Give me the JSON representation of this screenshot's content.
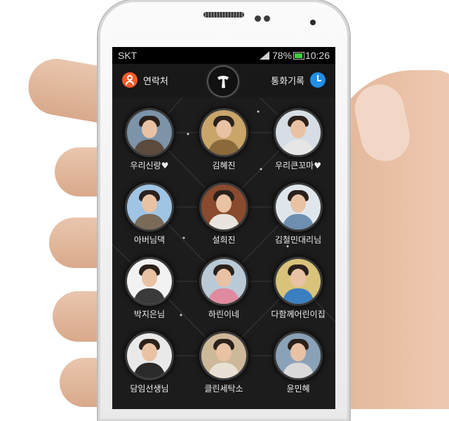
{
  "status_bar": {
    "carrier": "SKT",
    "battery": "78%",
    "time": "10:26"
  },
  "topbar": {
    "contacts_label": "연락처",
    "call_log_label": "통화기록"
  },
  "contacts": [
    {
      "name": "우리신랑♥",
      "bg": "#7c93a8",
      "body": "#5b4a3e"
    },
    {
      "name": "김혜진",
      "bg": "#c9a56a",
      "body": "#8a6a3b"
    },
    {
      "name": "우리큰꼬마♥",
      "bg": "#d7dde4",
      "body": "#e6e6e6"
    },
    {
      "name": "아버님댁",
      "bg": "#9fc4e4",
      "body": "#7a6a58"
    },
    {
      "name": "설희진",
      "bg": "#8a4a2e",
      "body": "#e9e4de"
    },
    {
      "name": "김철민대리님",
      "bg": "#dfe7ec",
      "body": "#6e8fb0"
    },
    {
      "name": "박지은님",
      "bg": "#f2f2f2",
      "body": "#3a3a3a"
    },
    {
      "name": "하린이네",
      "bg": "#b9c9d6",
      "body": "#e08aa0"
    },
    {
      "name": "다함께어린이집",
      "bg": "#d9c27a",
      "body": "#3b7fc0"
    },
    {
      "name": "담임선생님",
      "bg": "#e9e9e9",
      "body": "#2a2a2a"
    },
    {
      "name": "클린세탁소",
      "bg": "#cdb89a",
      "body": "#e8e0d4"
    },
    {
      "name": "윤민혜",
      "bg": "#8aa2b8",
      "body": "#d9d9d9"
    }
  ]
}
